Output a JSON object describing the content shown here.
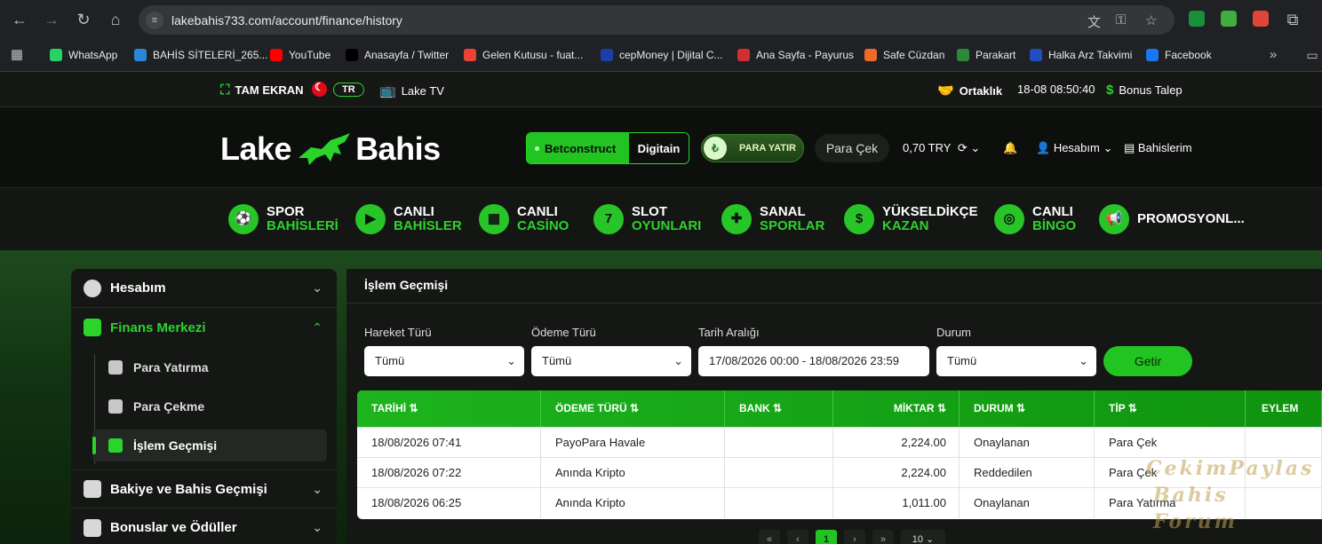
{
  "browser": {
    "url": "lakebahis733.com/account/finance/history",
    "bookmarks": [
      {
        "label": "WhatsApp",
        "color": "#25d366"
      },
      {
        "label": "BAHİS SİTELERİ_265...",
        "color": "#2b88d8"
      },
      {
        "label": "YouTube",
        "color": "#ff0000"
      },
      {
        "label": "Anasayfa / Twitter",
        "color": "#000000"
      },
      {
        "label": "Gelen Kutusu - fuat...",
        "color": "#ea4335"
      },
      {
        "label": "cepMoney | Dijital C...",
        "color": "#1a3fa8"
      },
      {
        "label": "Ana Sayfa - Payurus",
        "color": "#d03030"
      },
      {
        "label": "Safe Cüzdan",
        "color": "#f06a2a"
      },
      {
        "label": "Parakart",
        "color": "#2a8a3a"
      },
      {
        "label": "Halka Arz Takvimi",
        "color": "#1f4fbf"
      },
      {
        "label": "Facebook",
        "color": "#1877f2"
      }
    ]
  },
  "topbar": {
    "fullscreen": "TAM EKRAN",
    "lang": "TR",
    "tv": "Lake TV",
    "partner": "Ortaklık",
    "datetime": "18-08  08:50:40",
    "bonus": "Bonus Talep"
  },
  "header": {
    "logo_left": "Lake",
    "logo_right": "Bahis",
    "provider_a": "Betconstruct",
    "provider_b": "Digitain",
    "deposit": "PARA YATIR",
    "withdraw": "Para Çek",
    "balance": "0,70  TRY",
    "account": "Hesabım",
    "bets": "Bahislerim"
  },
  "menu": [
    {
      "t1": "SPOR",
      "t2": "BAHİSLERİ",
      "icon": "soccer-ball-icon"
    },
    {
      "t1": "CANLI",
      "t2": "BAHİSLER",
      "icon": "live-icon"
    },
    {
      "t1": "CANLI",
      "t2": "CASİNO",
      "icon": "casino-icon"
    },
    {
      "t1": "SLOT",
      "t2": "OYUNLARI",
      "icon": "seven-icon"
    },
    {
      "t1": "SANAL",
      "t2": "SPORLAR",
      "icon": "gamepad-icon"
    },
    {
      "t1": "YÜKSELDİKÇE",
      "t2": "KAZAN",
      "icon": "money-up-icon"
    },
    {
      "t1": "CANLI",
      "t2": "BİNGO",
      "icon": "bingo-icon"
    },
    {
      "t1": "PROMOSYONL...",
      "t2": "",
      "icon": "megaphone-icon"
    }
  ],
  "sidebar": {
    "items": [
      {
        "label": "Hesabım"
      },
      {
        "label": "Finans Merkezi"
      },
      {
        "label": "Bakiye ve Bahis Geçmişi"
      },
      {
        "label": "Bonuslar ve Ödüller"
      }
    ],
    "sub": [
      {
        "label": "Para Yatırma"
      },
      {
        "label": "Para Çekme"
      },
      {
        "label": "İşlem Geçmişi"
      }
    ]
  },
  "content": {
    "title": "İşlem Geçmişi",
    "filters": {
      "hareket_label": "Hareket Türü",
      "hareket_value": "Tümü",
      "odeme_label": "Ödeme Türü",
      "odeme_value": "Tümü",
      "tarih_label": "Tarih Aralığı",
      "tarih_value": "17/08/2026 00:00 - 18/08/2026 23:59",
      "durum_label": "Durum",
      "durum_value": "Tümü",
      "submit": "Getir"
    },
    "columns": [
      "TARİHİ",
      "ÖDEME TÜRÜ",
      "BANK",
      "MİKTAR",
      "DURUM",
      "TİP",
      "EYLEM"
    ],
    "rows": [
      [
        "18/08/2026 07:41",
        "PayoPara Havale",
        "",
        "2,224.00",
        "Onaylanan",
        "Para Çek",
        ""
      ],
      [
        "18/08/2026 07:22",
        "Anında Kripto",
        "",
        "2,224.00",
        "Reddedilen",
        "Para Çek",
        ""
      ],
      [
        "18/08/2026 06:25",
        "Anında Kripto",
        "",
        "1,011.00",
        "Onaylanan",
        "Para Yatırma",
        ""
      ]
    ],
    "pager": {
      "current": "1",
      "page_size": "10"
    }
  },
  "watermark": {
    "line1": "CekimPaylas",
    "line2": "Bahis Forum"
  },
  "colors": {
    "accent": "#22c422",
    "bg": "#151715"
  }
}
